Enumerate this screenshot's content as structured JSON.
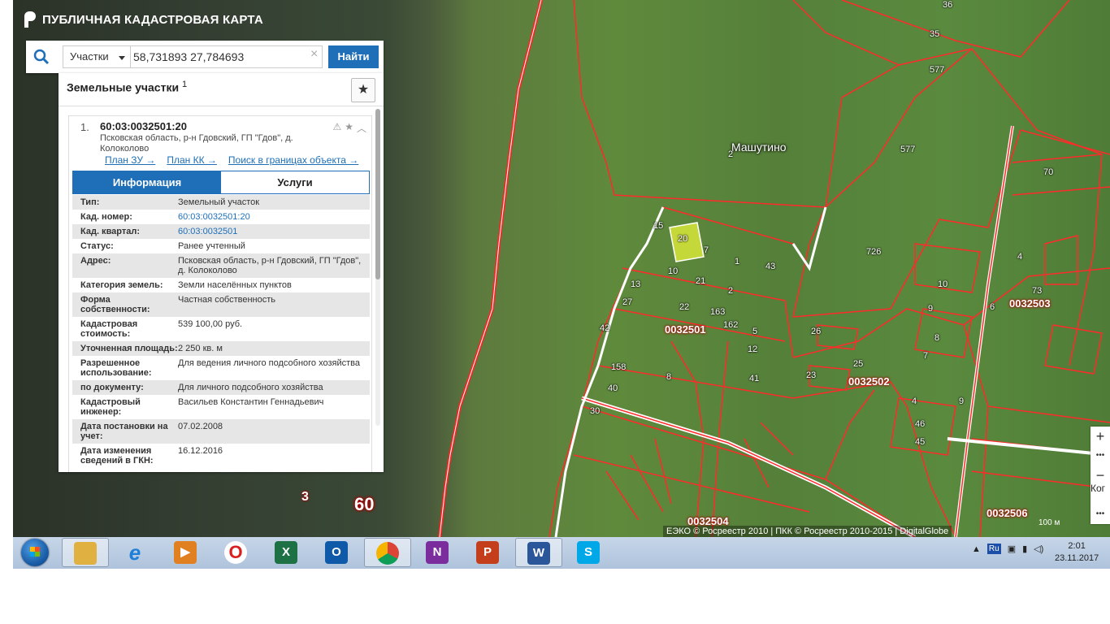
{
  "app": {
    "title": "ПУБЛИЧНАЯ КАДАСТРОВАЯ КАРТА"
  },
  "search": {
    "type_label": "Участки",
    "query": "58,731893 27,784693",
    "find_label": "Найти"
  },
  "panel": {
    "header": "Земельные участки",
    "count": "1",
    "item": {
      "num": "1.",
      "cad_number": "60:03:0032501:20",
      "address": "Псковская область, р-н Гдовский, ГП \"Гдов\", д. Колоколово",
      "links": [
        "План ЗУ →",
        "План КК →",
        "Поиск в границах объекта →"
      ],
      "tabs": [
        "Информация",
        "Услуги"
      ],
      "attributes": [
        {
          "k": "Тип:",
          "v": "Земельный участок"
        },
        {
          "k": "Кад. номер:",
          "v": "60:03:0032501:20",
          "link": true
        },
        {
          "k": "Кад. квартал:",
          "v": "60:03:0032501",
          "link": true
        },
        {
          "k": "Статус:",
          "v": "Ранее учтенный"
        },
        {
          "k": "Адрес:",
          "v": "Псковская область, р-н Гдовский, ГП \"Гдов\", д. Колоколово"
        },
        {
          "k": "Категория земель:",
          "v": "Земли населённых пунктов"
        },
        {
          "k": "Форма собственности:",
          "v": "Частная собственность"
        },
        {
          "k": "Кадастровая стоимость:",
          "v": "539 100,00 руб."
        },
        {
          "k": "Уточненная площадь:",
          "v": "2 250 кв. м"
        },
        {
          "k": "Разрешенное использование:",
          "v": "Для ведения личного подсобного хозяйства"
        },
        {
          "k": "по документу:",
          "v": "Для личного подсобного хозяйства"
        },
        {
          "k": "Кадастровый инженер:",
          "v": "Васильев Константин Геннадьевич"
        },
        {
          "k": "Дата постановки на учет:",
          "v": "07.02.2008"
        },
        {
          "k": "Дата изменения сведений в ГКН:",
          "v": "16.12.2016"
        }
      ]
    }
  },
  "map": {
    "village": "Машутино",
    "quarters": [
      "0032501",
      "0032502",
      "0032503",
      "0032504",
      "0032506"
    ],
    "region_number": "60",
    "district_number": "3",
    "plot_labels": [
      "36",
      "35",
      "577",
      "577",
      "70",
      "726",
      "20",
      "7",
      "1",
      "43",
      "15",
      "10",
      "21",
      "2",
      "13",
      "27",
      "22",
      "163",
      "162",
      "5",
      "12",
      "26",
      "25",
      "23",
      "4",
      "10",
      "9",
      "6",
      "73",
      "42",
      "158",
      "40",
      "8",
      "41",
      "30",
      "4",
      "8",
      "7",
      "9",
      "46",
      "45",
      "2"
    ],
    "attribution": "ЕЭКО © Росреестр 2010 | ПКК © Росреестр 2010-2015 | DigitalGlobe",
    "scale": "100 м",
    "partial_label": "Ког"
  },
  "zoom": {
    "plus": "+",
    "minus": "−",
    "more": "•••"
  },
  "taskbar": {
    "apps": [
      {
        "name": "explorer",
        "label": "",
        "color": "#e0b040",
        "active": true
      },
      {
        "name": "ie",
        "label": "e",
        "color": "#1e7fd8",
        "active": false
      },
      {
        "name": "media-player",
        "label": "▶",
        "color": "#e08020",
        "active": false
      },
      {
        "name": "opera",
        "label": "O",
        "color": "#d8201e",
        "active": false
      },
      {
        "name": "excel",
        "label": "X",
        "color": "#1e7145",
        "active": false
      },
      {
        "name": "outlook",
        "label": "O",
        "color": "#0f5aa8",
        "active": false
      },
      {
        "name": "chrome",
        "label": "",
        "color": "#4a90e2",
        "active": true
      },
      {
        "name": "onenote",
        "label": "N",
        "color": "#7b2d9e",
        "active": false
      },
      {
        "name": "powerpoint",
        "label": "P",
        "color": "#c43e1c",
        "active": false
      },
      {
        "name": "word",
        "label": "W",
        "color": "#2b579a",
        "active": true
      },
      {
        "name": "skype",
        "label": "S",
        "color": "#00a8e8",
        "active": false
      }
    ],
    "tray": {
      "lang": "Ru",
      "time": "2:01",
      "date": "23.11.2017"
    }
  }
}
